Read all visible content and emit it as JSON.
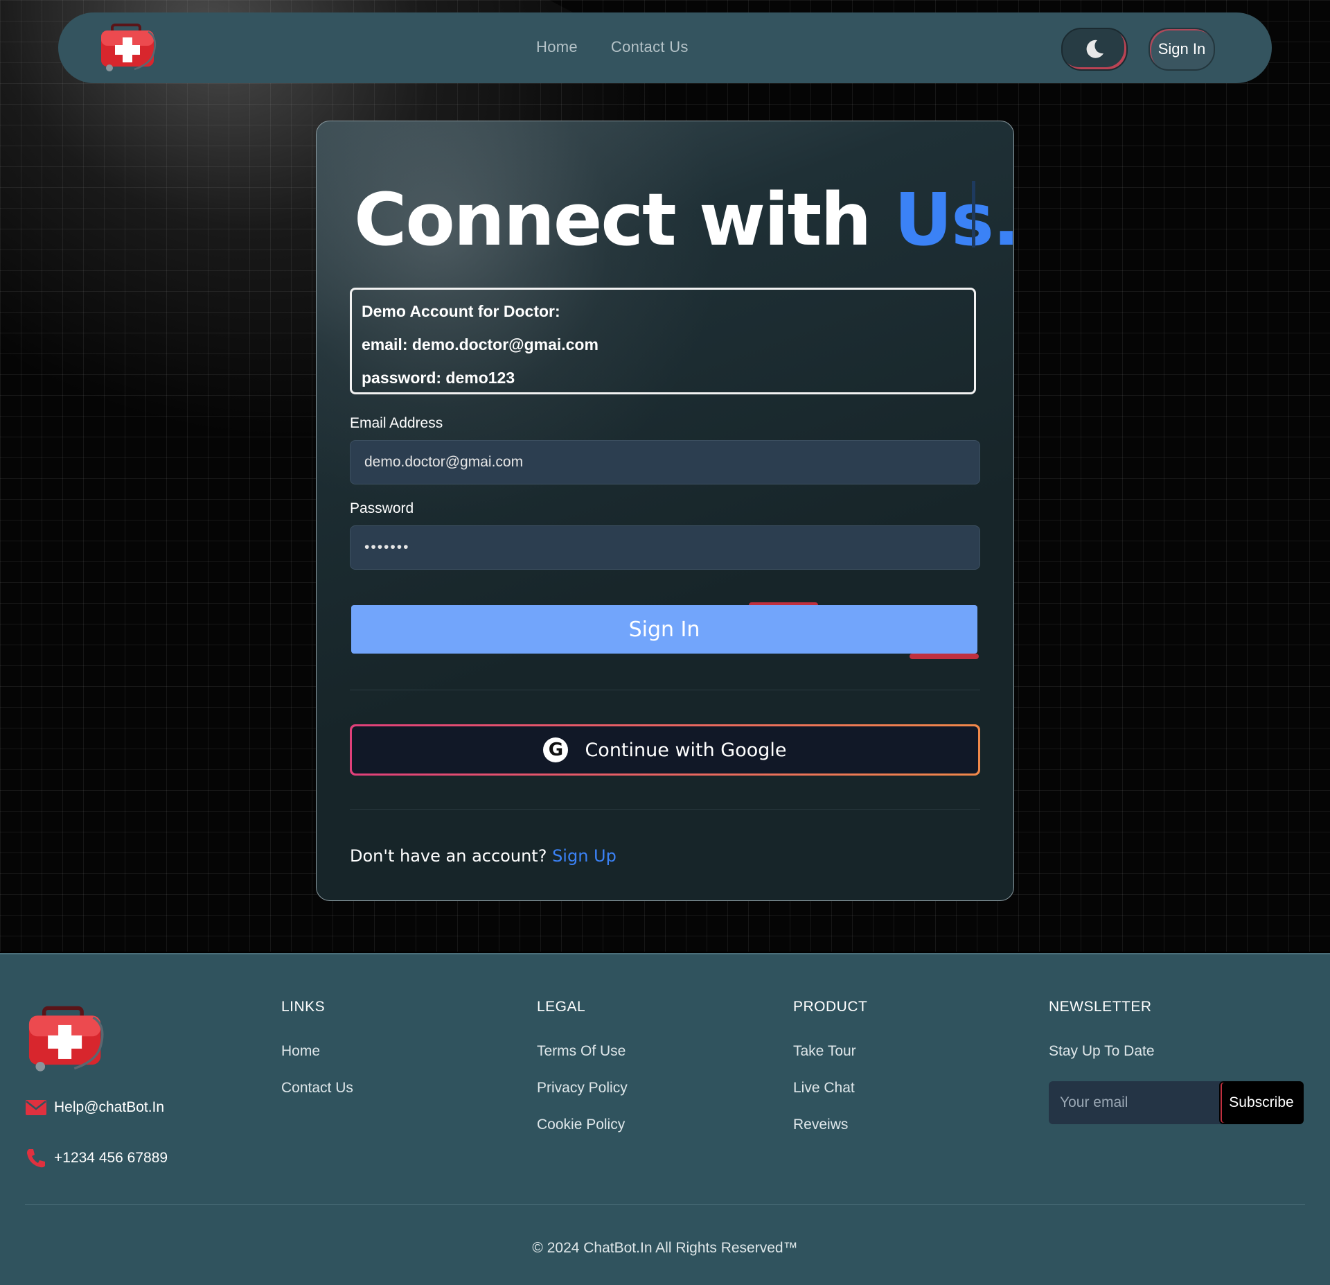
{
  "nav": {
    "logo": "medical-kit-icon",
    "links": [
      "Home",
      "Contact Us"
    ],
    "theme_icon": "moon-icon",
    "signin_label": "Sign In"
  },
  "card": {
    "heading_main": "Connect with ",
    "heading_accent": "Us.",
    "demo": {
      "title": "Demo Account for Doctor:",
      "email": "email: demo.doctor@gmai.com",
      "password": "password: demo123"
    },
    "email_label": "Email Address",
    "email_value": "demo.doctor@gmai.com",
    "password_label": "Password",
    "password_value": "demo123",
    "signin_button": "Sign In",
    "google_button": "Continue with Google",
    "google_icon": "google-icon",
    "signup_prompt": "Don't have an account? ",
    "signup_link": "Sign Up"
  },
  "footer": {
    "logo": "medical-kit-icon",
    "email": "Help@chatBot.In",
    "email_icon": "mail-icon",
    "phone": "+1234 456 67889",
    "phone_icon": "phone-icon",
    "links": {
      "title": "LINKS",
      "items": [
        "Home",
        "Contact Us"
      ]
    },
    "legal": {
      "title": "LEGAL",
      "items": [
        "Terms Of Use",
        "Privacy Policy",
        "Cookie Policy"
      ]
    },
    "product": {
      "title": "PRODUCT",
      "items": [
        "Take Tour",
        "Live Chat",
        "Reveiws"
      ]
    },
    "newsletter": {
      "title": "NEWSLETTER",
      "subtitle": "Stay Up To Date",
      "placeholder": "Your email",
      "button": "Subscribe"
    },
    "copyright": "© 2024 ChatBot.In All Rights Reserved™"
  },
  "colors": {
    "accent_blue": "#3b82f6",
    "signin_button": "#72a5fb",
    "navbar": "#34545f",
    "footer": "#30535e",
    "brand_red": "#e0313f"
  }
}
